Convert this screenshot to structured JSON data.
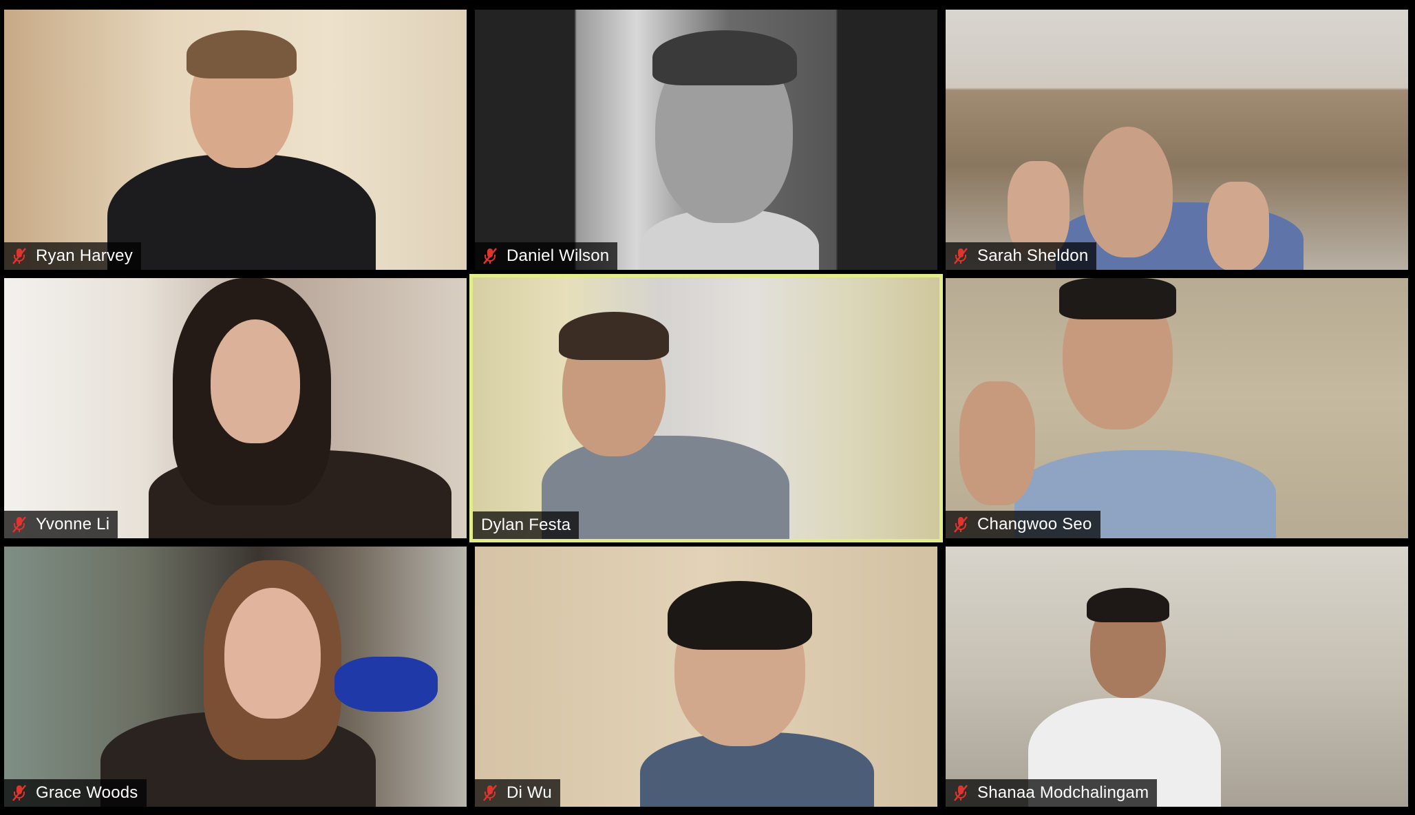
{
  "app": {
    "view": "gallery",
    "colors": {
      "background": "#000000",
      "active_speaker_border": "#e2ec8a",
      "muted_icon": "#e0342f",
      "label_text": "#ffffff"
    }
  },
  "participants": [
    {
      "name": "Ryan Harvey",
      "muted": true,
      "active": false
    },
    {
      "name": "Daniel Wilson",
      "muted": true,
      "active": false
    },
    {
      "name": "Sarah Sheldon",
      "muted": true,
      "active": false
    },
    {
      "name": "Yvonne Li",
      "muted": true,
      "active": false
    },
    {
      "name": "Dylan Festa",
      "muted": false,
      "active": true
    },
    {
      "name": "Changwoo Seo",
      "muted": true,
      "active": false
    },
    {
      "name": "Grace Woods",
      "muted": true,
      "active": false
    },
    {
      "name": "Di Wu",
      "muted": true,
      "active": false
    },
    {
      "name": "Shanaa Modchalingam",
      "muted": true,
      "active": false
    }
  ],
  "icons": {
    "muted": "muted-microphone-icon"
  }
}
